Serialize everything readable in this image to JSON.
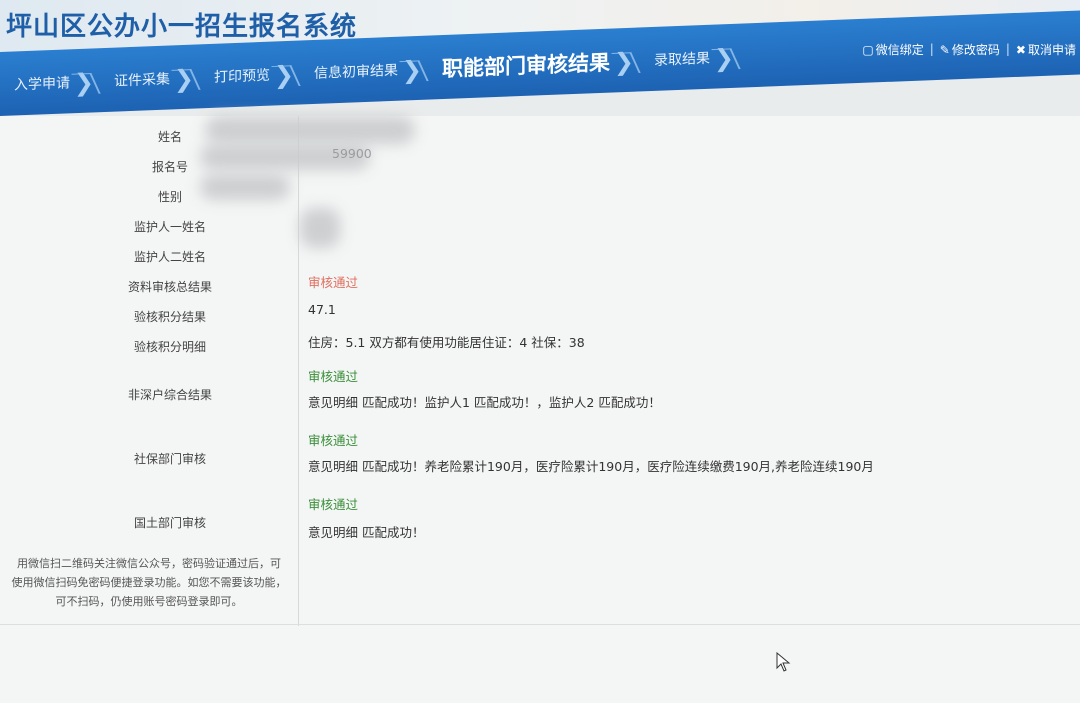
{
  "header": {
    "title": "坪山区公办小一招生报名系统",
    "links": [
      {
        "icon": "window-icon",
        "label": "微信绑定"
      },
      {
        "icon": "pencil-icon",
        "label": "修改密码"
      },
      {
        "icon": "x-icon",
        "label": "取消申请"
      }
    ]
  },
  "steps": [
    {
      "label": "入学申请",
      "active": false
    },
    {
      "label": "证件采集",
      "active": false
    },
    {
      "label": "打印预览",
      "active": false
    },
    {
      "label": "信息初审结果",
      "active": false
    },
    {
      "label": "职能部门审核结果",
      "active": true
    },
    {
      "label": "录取结果",
      "active": false
    }
  ],
  "form": {
    "labels": {
      "name": "姓名",
      "reg_no": "报名号",
      "gender": "性别",
      "guardian1": "监护人一姓名",
      "guardian2": "监护人二姓名",
      "material_result": "资料审核总结果",
      "points_result": "验核积分结果",
      "points_detail": "验核积分明细",
      "non_sz_result": "非深户综合结果",
      "social_security": "社保部门审核",
      "land_dept": "国土部门审核"
    },
    "values": {
      "reg_no_partial": "59900",
      "material_result": "审核通过",
      "points_result": "47.1",
      "points_detail": "住房：5.1 双方都有使用功能居住证：4 社保：38",
      "non_sz_status": "审核通过",
      "non_sz_detail": "意见明细 匹配成功！监护人1 匹配成功！，监护人2 匹配成功！",
      "ss_status": "审核通过",
      "ss_detail": "意见明细 匹配成功！养老险累计190月，医疗险累计190月，医疗险连续缴费190月,养老险连续190月",
      "land_status": "审核通过",
      "land_detail": "意见明细 匹配成功！"
    }
  },
  "note": [
    "用微信扫二维码关注微信公众号，密码验证通过后，可",
    "使用微信扫码免密码便捷登录功能。如您不需要该功能，",
    "可不扫码，仍使用账号密码登录即可。"
  ],
  "colors": {
    "nav_blue": "#1d62b3",
    "title_blue": "#1f5fa8",
    "pass_green": "#3a8f3a",
    "pass_red": "#e07060"
  }
}
